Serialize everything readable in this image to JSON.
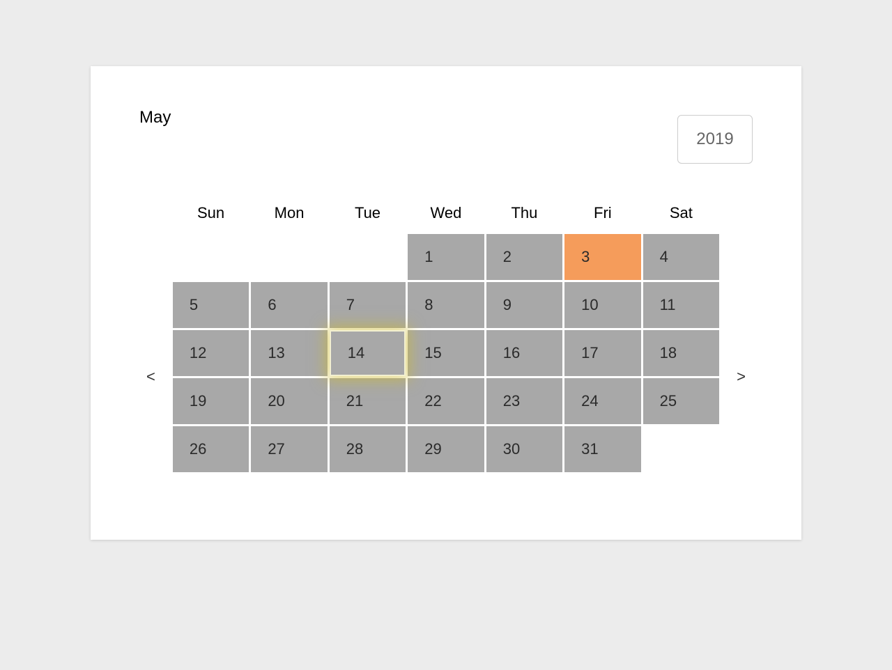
{
  "month": "May",
  "year": "2019",
  "nav": {
    "prev": "<",
    "next": ">"
  },
  "weekdays": [
    "Sun",
    "Mon",
    "Tue",
    "Wed",
    "Thu",
    "Fri",
    "Sat"
  ],
  "weeks": [
    [
      {
        "day": "",
        "empty": true
      },
      {
        "day": "",
        "empty": true
      },
      {
        "day": "",
        "empty": true
      },
      {
        "day": "1"
      },
      {
        "day": "2"
      },
      {
        "day": "3",
        "selected": true
      },
      {
        "day": "4"
      }
    ],
    [
      {
        "day": "5"
      },
      {
        "day": "6"
      },
      {
        "day": "7"
      },
      {
        "day": "8"
      },
      {
        "day": "9"
      },
      {
        "day": "10"
      },
      {
        "day": "11"
      }
    ],
    [
      {
        "day": "12"
      },
      {
        "day": "13"
      },
      {
        "day": "14",
        "today": true
      },
      {
        "day": "15"
      },
      {
        "day": "16"
      },
      {
        "day": "17"
      },
      {
        "day": "18"
      }
    ],
    [
      {
        "day": "19"
      },
      {
        "day": "20"
      },
      {
        "day": "21"
      },
      {
        "day": "22"
      },
      {
        "day": "23"
      },
      {
        "day": "24"
      },
      {
        "day": "25"
      }
    ],
    [
      {
        "day": "26"
      },
      {
        "day": "27"
      },
      {
        "day": "28"
      },
      {
        "day": "29"
      },
      {
        "day": "30"
      },
      {
        "day": "31"
      },
      {
        "day": "",
        "empty": true
      }
    ]
  ]
}
